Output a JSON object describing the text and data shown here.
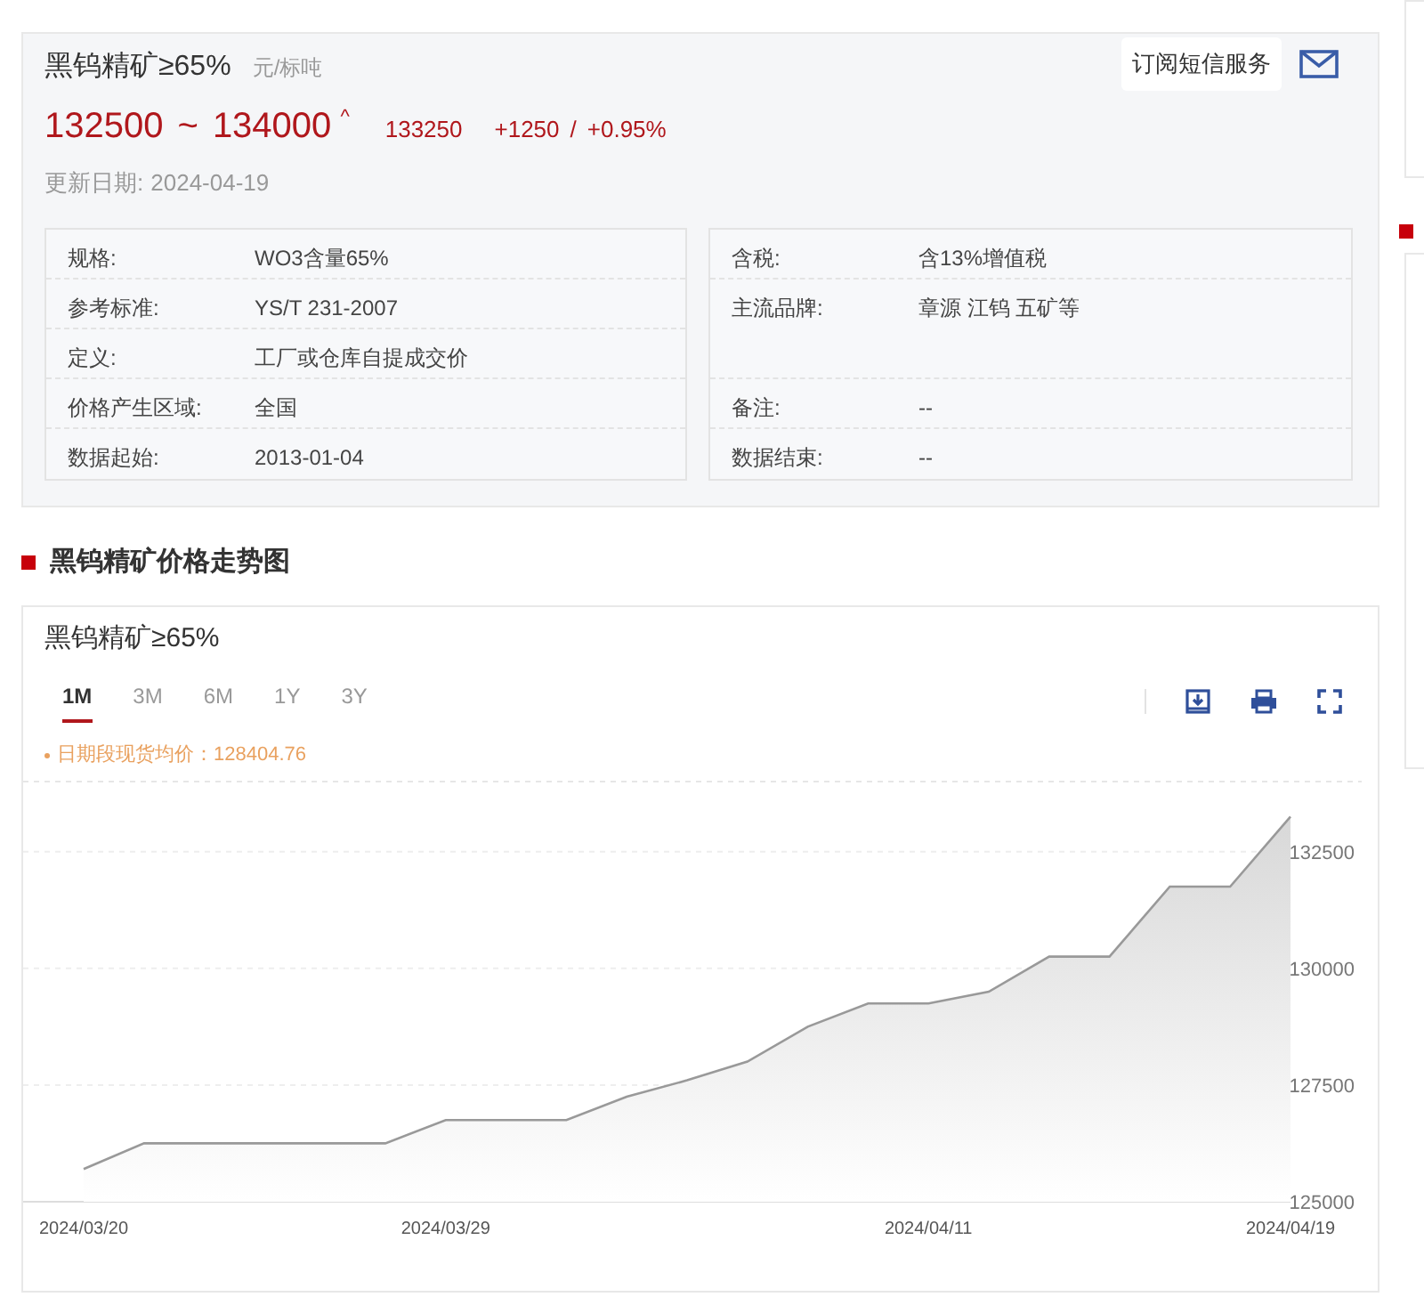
{
  "quote": {
    "name": "黑钨精矿≥65%",
    "unit": "元/标吨",
    "low": "132500",
    "separator": "~",
    "high": "134000",
    "trend_symbol": "^",
    "average": "133250",
    "change": "+1250",
    "change_separator": "/",
    "change_pct": "+0.95%",
    "updated_label": "更新日期:",
    "updated_date": "2024-04-19",
    "subscribe": "订阅短信服务"
  },
  "specs_left": [
    {
      "label": "规格:",
      "value": "WO3含量65%"
    },
    {
      "label": "参考标准:",
      "value": "YS/T 231-2007"
    },
    {
      "label": "定义:",
      "value": "工厂或仓库自提成交价"
    },
    {
      "label": "价格产生区域:",
      "value": "全国"
    },
    {
      "label": "数据起始:",
      "value": "2013-01-04"
    }
  ],
  "specs_right": [
    {
      "label": "含税:",
      "value": "含13%增值税"
    },
    {
      "label": "主流品牌:",
      "value": "章源 江钨 五矿等"
    },
    {
      "label": "备注:",
      "value": "--"
    },
    {
      "label": "数据结束:",
      "value": "--"
    }
  ],
  "trend": {
    "heading": "黑钨精矿价格走势图",
    "ranges": [
      {
        "label": "1M",
        "selected": true
      },
      {
        "label": "3M",
        "selected": false
      },
      {
        "label": "6M",
        "selected": false
      },
      {
        "label": "1Y",
        "selected": false
      },
      {
        "label": "3Y",
        "selected": false
      }
    ],
    "average_note": "日期段现货均价：128404.76",
    "chart_data": {
      "type": "area",
      "categories": [
        "2024/03/20",
        null,
        null,
        null,
        null,
        null,
        "2024/03/29",
        null,
        null,
        null,
        null,
        null,
        null,
        null,
        "2024/04/11",
        null,
        null,
        null,
        null,
        null,
        "2024/04/19"
      ],
      "series": [
        {
          "name": "黑钨精矿≥65%",
          "color": "#999999",
          "values": [
            125700,
            126250,
            126250,
            126250,
            126250,
            126250,
            126750,
            126750,
            126750,
            127250,
            127600,
            128000,
            128750,
            129250,
            129250,
            129500,
            130250,
            130250,
            131750,
            131750,
            133250
          ]
        }
      ],
      "ylim": [
        125000,
        134000
      ],
      "yticks": [
        125000,
        127500,
        130000,
        132500
      ],
      "grid": true
    }
  }
}
